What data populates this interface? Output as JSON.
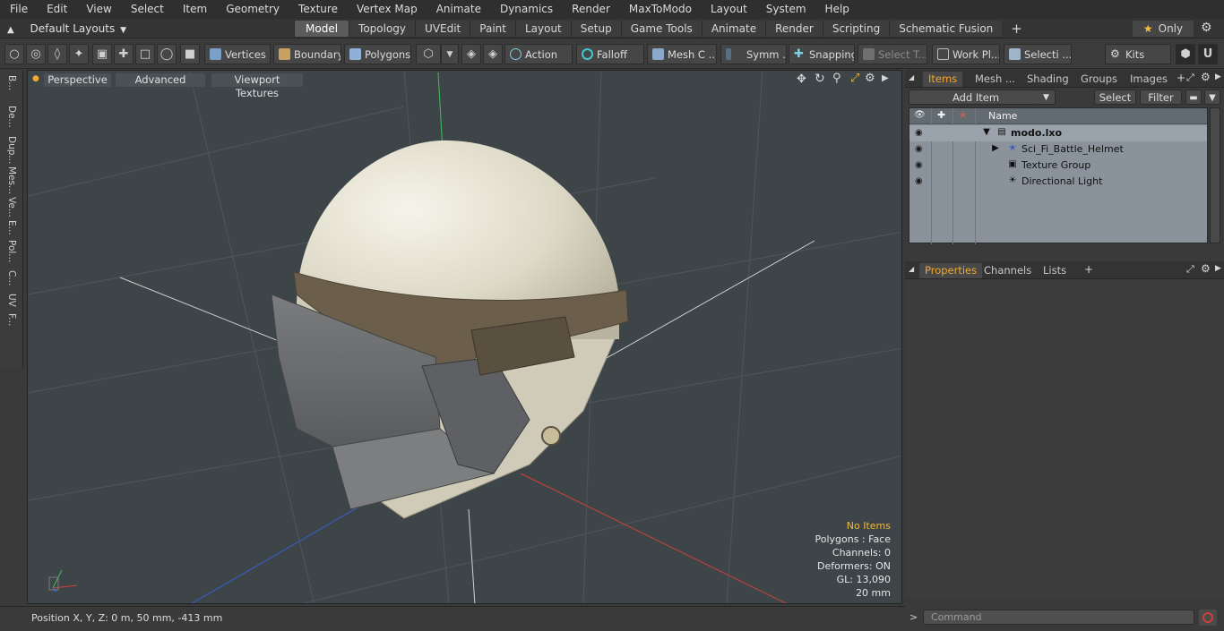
{
  "menu": [
    "File",
    "Edit",
    "View",
    "Select",
    "Item",
    "Geometry",
    "Texture",
    "Vertex Map",
    "Animate",
    "Dynamics",
    "Render",
    "MaxToModo",
    "Layout",
    "System",
    "Help"
  ],
  "layouts_label": "Default Layouts",
  "layout_tabs": [
    "Model",
    "Topology",
    "UVEdit",
    "Paint",
    "Layout",
    "Setup",
    "Game Tools",
    "Animate",
    "Render",
    "Scripting",
    "Schematic Fusion"
  ],
  "active_tab": "Model",
  "only_label": "Only",
  "toolbar": {
    "vertices": "Vertices",
    "boundary": "Boundary",
    "polygons": "Polygons",
    "action": "Action",
    "falloff": "Falloff",
    "mesh": "Mesh C ...",
    "symm": "Symm ...",
    "snapping": "Snapping",
    "select_t": "Select T...",
    "work_pl": "Work Pl...",
    "selecti": "Selecti ...",
    "kits": "Kits"
  },
  "left_strip": [
    "B...",
    "De...",
    "Dup...",
    "Mes...",
    "Ve...",
    "E...",
    "Pol...",
    "C...",
    "UV",
    "F..."
  ],
  "viewport": {
    "perspective": "Perspective",
    "advanced": "Advanced",
    "viewport_textures": "Viewport Textures",
    "hud": {
      "no_items": "No Items",
      "polygons": "Polygons : Face",
      "channels": "Channels: 0",
      "deformers": "Deformers: ON",
      "gl": "GL: 13,090",
      "scale": "20 mm"
    }
  },
  "status": {
    "position": "Position X, Y, Z:   0 m, 50 mm, -413 mm"
  },
  "items_panel": {
    "tabs": [
      "Items",
      "Mesh ...",
      "Shading",
      "Groups",
      "Images"
    ],
    "active_tab": "Items",
    "add_item": "Add Item",
    "select": "Select",
    "filter": "Filter",
    "name_header": "Name",
    "rows": [
      {
        "label": "modo.lxo"
      },
      {
        "label": "Sci_Fi_Battle_Helmet"
      },
      {
        "label": "Texture Group"
      },
      {
        "label": "Directional Light"
      }
    ]
  },
  "properties_panel": {
    "tabs": [
      "Properties",
      "Channels",
      "Lists"
    ],
    "active_tab": "Properties"
  },
  "command_placeholder": "Command",
  "colors": {
    "accent": "#f0a830",
    "viewport_bg": "#3d4549",
    "axis_x": "#d0403a",
    "axis_y": "#3fbf5a",
    "axis_z": "#3a5fd0",
    "helmet_shell": "#e4e0cf",
    "helmet_band": "#6b5e4a",
    "helmet_visor": "#6c6e70"
  }
}
